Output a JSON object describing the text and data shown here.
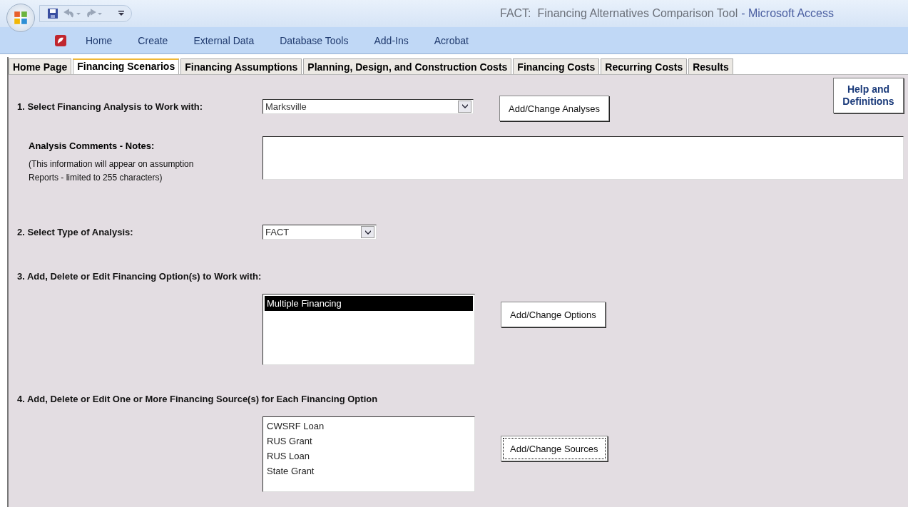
{
  "window": {
    "title": "FACT:  Financing Alternatives Comparison Tool",
    "app_name": "- Microsoft Access"
  },
  "ribbon_tabs": [
    "Home",
    "Create",
    "External Data",
    "Database Tools",
    "Add-Ins",
    "Acrobat"
  ],
  "tabs": [
    {
      "label": "Home Page",
      "selected": false
    },
    {
      "label": "Financing Scenarios",
      "selected": true
    },
    {
      "label": "Financing Assumptions",
      "selected": false
    },
    {
      "label": "Planning, Design, and Construction Costs",
      "selected": false
    },
    {
      "label": "Financing Costs",
      "selected": false
    },
    {
      "label": "Recurring Costs",
      "selected": false
    },
    {
      "label": "Results",
      "selected": false
    }
  ],
  "help_button": "Help and Definitions",
  "step1": {
    "label": "1. Select Financing Analysis to Work with:",
    "value": "Marksville",
    "button": {
      "label": "Add/Change Analyses",
      "focused": false
    }
  },
  "comments": {
    "label": "Analysis Comments - Notes:",
    "hint": "(This information will appear on  assumption Reports - limited to 255 characters)"
  },
  "step2": {
    "label": "2. Select Type of Analysis:",
    "value": "FACT"
  },
  "step3": {
    "label": "3. Add, Delete or Edit Financing Option(s) to Work with:",
    "items": [
      {
        "label": "Multiple Financing",
        "selected": true
      }
    ],
    "button": {
      "label": "Add/Change Options",
      "focused": false
    }
  },
  "step4": {
    "label": "4. Add, Delete or Edit One or More Financing Source(s) for Each Financing Option",
    "items": [
      {
        "label": "CWSRF Loan",
        "selected": false
      },
      {
        "label": "RUS Grant",
        "selected": false
      },
      {
        "label": "RUS Loan",
        "selected": false
      },
      {
        "label": "State Grant",
        "selected": false
      }
    ],
    "button": {
      "label": "Add/Change Sources",
      "focused": true
    }
  }
}
